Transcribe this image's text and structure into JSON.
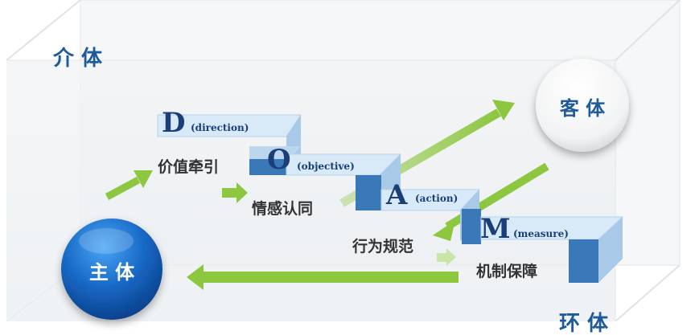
{
  "labels": {
    "mediator": "介 体",
    "subject": "主 体",
    "object": "客 体",
    "environment": "环 体"
  },
  "steps": [
    {
      "letter": "D",
      "term": "(direction)",
      "cn": "价值牵引"
    },
    {
      "letter": "O",
      "term": "(objective)",
      "cn": "情感认同"
    },
    {
      "letter": "A",
      "term": "(action)",
      "cn": "行为规范"
    },
    {
      "letter": "M",
      "term": "(measure)",
      "cn": "机制保障"
    }
  ],
  "colors": {
    "arrow_green": "#8dc63f",
    "block_blue": "#3a78b8",
    "block_top": "#d6e8f8",
    "label_blue": "#1f5b9a",
    "subject_circle": "#1667c4"
  }
}
